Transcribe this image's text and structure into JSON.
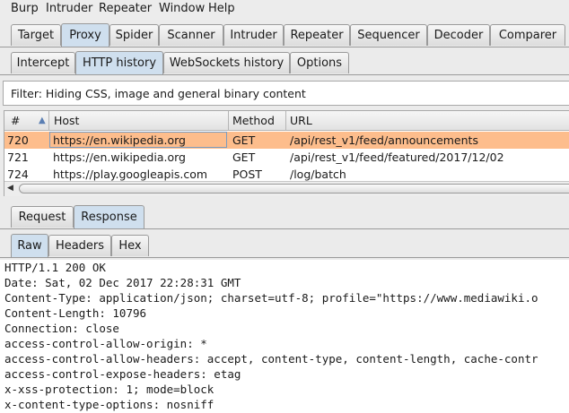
{
  "menu": [
    "Burp",
    "Intruder",
    "Repeater",
    "Window",
    "Help"
  ],
  "main_tabs": [
    "Target",
    "Proxy",
    "Spider",
    "Scanner",
    "Intruder",
    "Repeater",
    "Sequencer",
    "Decoder",
    "Comparer"
  ],
  "proxy_tabs": [
    "Intercept",
    "HTTP history",
    "WebSockets history",
    "Options"
  ],
  "filter_text": "Filter: Hiding CSS, image and general binary content",
  "table": {
    "headers": [
      "#",
      "Host",
      "Method",
      "URL"
    ],
    "sort_glyph": "▲",
    "rows": [
      {
        "num": "720",
        "host": "https://en.wikipedia.org",
        "method": "GET",
        "url": "/api/rest_v1/feed/announcements"
      },
      {
        "num": "721",
        "host": "https://en.wikipedia.org",
        "method": "GET",
        "url": "/api/rest_v1/feed/featured/2017/12/02"
      },
      {
        "num": "724",
        "host": "https://play.googleapis.com",
        "method": "POST",
        "url": "/log/batch"
      }
    ]
  },
  "message_tabs": [
    "Request",
    "Response"
  ],
  "view_tabs": [
    "Raw",
    "Headers",
    "Hex"
  ],
  "response_lines": [
    "HTTP/1.1 200 OK",
    "Date: Sat, 02 Dec 2017 22:28:31 GMT",
    "Content-Type: application/json; charset=utf-8; profile=\"https://www.mediawiki.o",
    "Content-Length: 10796",
    "Connection: close",
    "access-control-allow-origin: *",
    "access-control-allow-headers: accept, content-type, content-length, cache-contr",
    "access-control-expose-headers: etag",
    "x-xss-protection: 1; mode=block",
    "x-content-type-options: nosniff"
  ]
}
